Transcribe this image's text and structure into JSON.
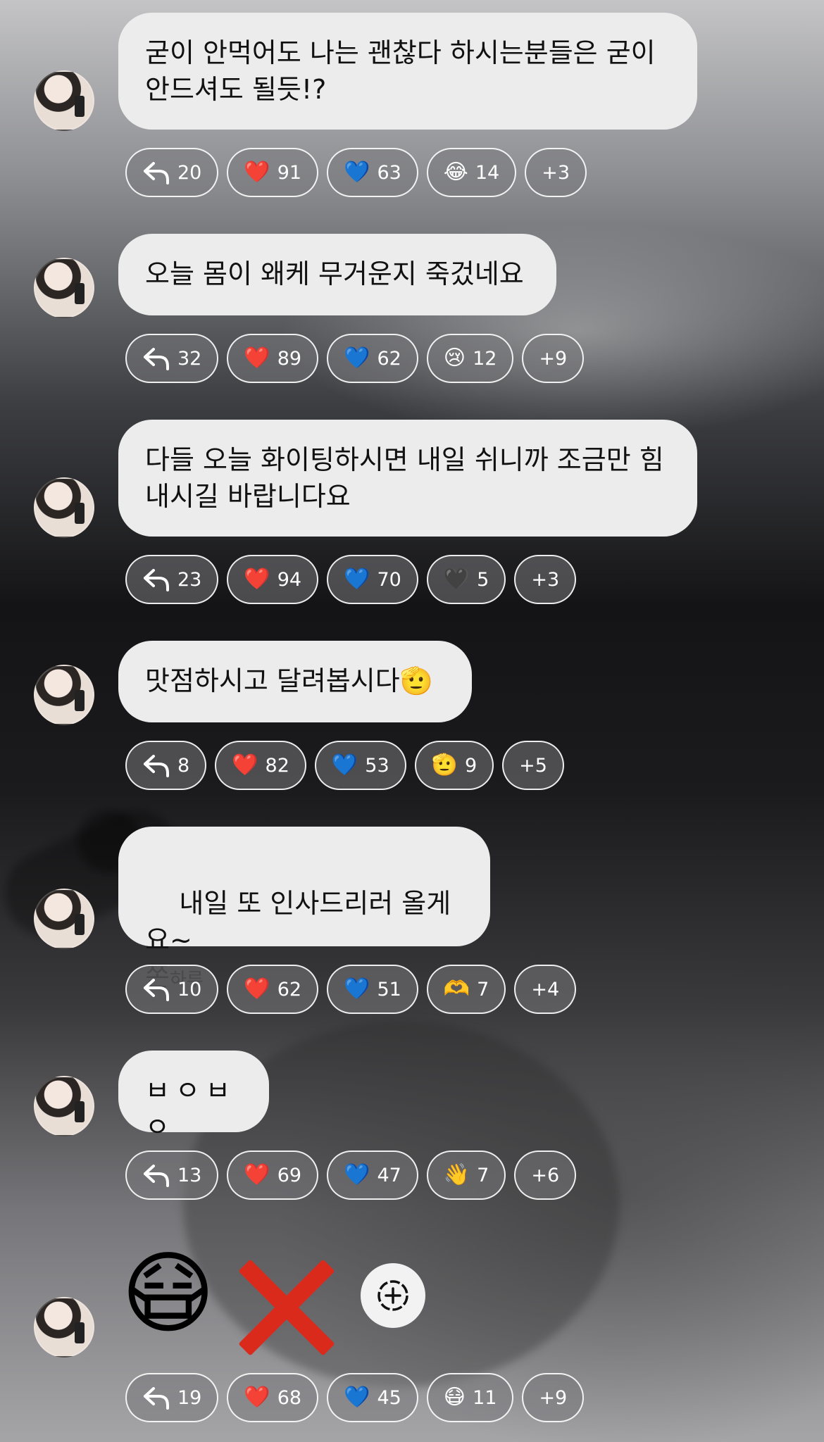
{
  "messages": [
    {
      "text": "굳이 안먹어도 나는 괜찮다 하시는분들은 굳이\n안드셔도 될듯!?",
      "reactions": {
        "replies": "20",
        "heart": "91",
        "blue_heart": "63",
        "extra_emoji": "😂",
        "extra_count": "14",
        "more": "+3"
      }
    },
    {
      "text": "오늘 몸이 왜케 무거운지 죽겄네요",
      "reactions": {
        "replies": "32",
        "heart": "89",
        "blue_heart": "62",
        "extra_emoji": "😢",
        "extra_count": "12",
        "more": "+9"
      }
    },
    {
      "text": "다들 오늘 화이팅하시면 내일 쉬니까 조금만 힘\n내시길 바랍니다요",
      "reactions": {
        "replies": "23",
        "heart": "94",
        "blue_heart": "70",
        "extra_emoji": "🖤",
        "extra_count": "5",
        "more": "+3"
      }
    },
    {
      "text": "맛점하시고 달려봅시다🫡",
      "reactions": {
        "replies": "8",
        "heart": "82",
        "blue_heart": "53",
        "extra_emoji": "🫡",
        "extra_count": "9",
        "more": "+5"
      }
    },
    {
      "text": "내일 또 인사드리러 올게요~\n쫀",
      "sub_text": "하루",
      "reactions": {
        "replies": "10",
        "heart": "62",
        "blue_heart": "51",
        "extra_emoji": "🫶",
        "extra_count": "7",
        "more": "+4"
      }
    },
    {
      "text": "ㅂㅇㅂㅇ",
      "reactions": {
        "replies": "13",
        "heart": "69",
        "blue_heart": "47",
        "extra_emoji": "👋",
        "extra_count": "7",
        "more": "+6"
      }
    },
    {
      "emoji_1": "😷",
      "reactions": {
        "replies": "19",
        "heart": "68",
        "blue_heart": "45",
        "extra_emoji": "😷",
        "extra_count": "11",
        "more": "+9"
      }
    }
  ],
  "icons": {
    "heart": "❤️",
    "blue_heart": "💙",
    "reply": "reply-arrow-icon",
    "add_reaction": "add-reaction-icon",
    "cross_mark": "cross-mark-icon"
  }
}
